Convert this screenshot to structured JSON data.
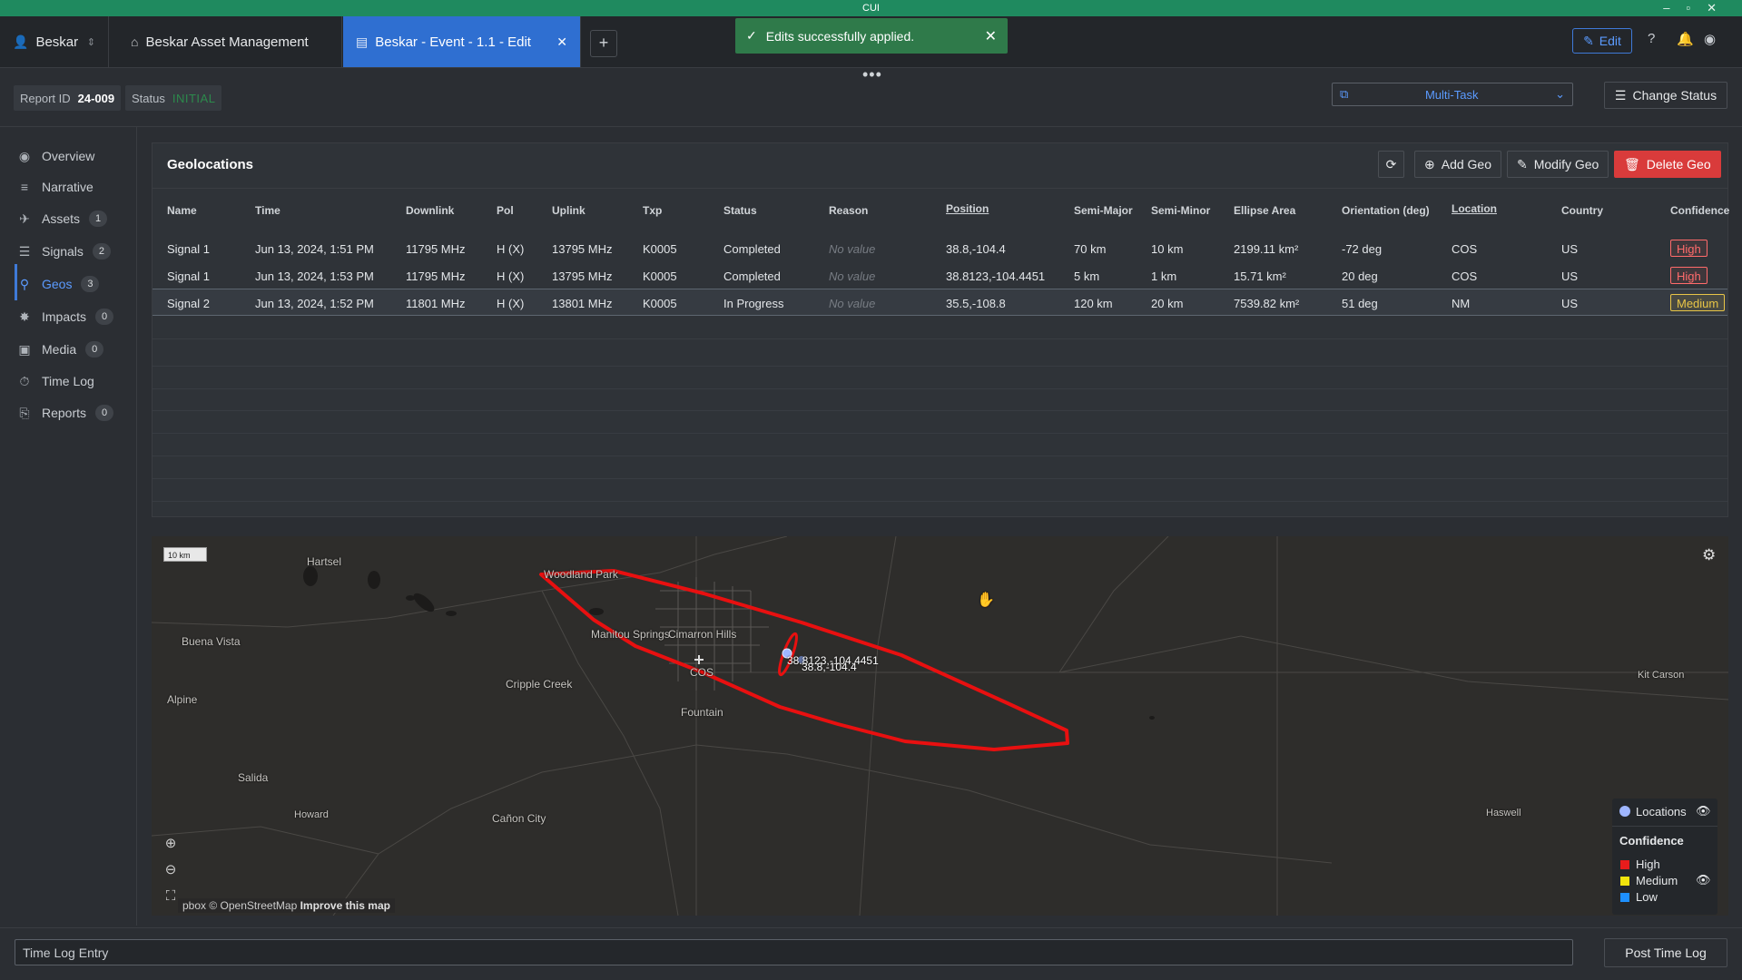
{
  "banner": {
    "classification": "CUI"
  },
  "tabs": [
    {
      "label": "Beskar",
      "icon": "user-badge-icon"
    },
    {
      "label": "Beskar Asset Management",
      "icon": "home-icon"
    },
    {
      "label": "Beskar - Event - 1.1 - Edit",
      "icon": "window-icon"
    }
  ],
  "toast": {
    "message": "Edits successfully applied."
  },
  "header": {
    "edit_label": "Edit"
  },
  "report": {
    "id_label": "Report ID",
    "id_value": "24-009",
    "status_label": "Status",
    "status_value": "INITIAL"
  },
  "toolbar": {
    "ellipsis": "•••",
    "multitask_label": "Multi-Task",
    "change_status_label": "Change Status"
  },
  "sidebar": {
    "items": [
      {
        "label": "Overview",
        "icon": "eye-icon",
        "count": ""
      },
      {
        "label": "Narrative",
        "icon": "lines-icon",
        "count": ""
      },
      {
        "label": "Assets",
        "icon": "plane-icon",
        "count": "1"
      },
      {
        "label": "Signals",
        "icon": "signal-icon",
        "count": "2"
      },
      {
        "label": "Geos",
        "icon": "pin-icon",
        "count": "3"
      },
      {
        "label": "Impacts",
        "icon": "burst-icon",
        "count": "0"
      },
      {
        "label": "Media",
        "icon": "image-icon",
        "count": "0"
      },
      {
        "label": "Time Log",
        "icon": "stopwatch-icon",
        "count": ""
      },
      {
        "label": "Reports",
        "icon": "paperclip-icon",
        "count": "0"
      }
    ]
  },
  "geolocations": {
    "title": "Geolocations",
    "buttons": {
      "add": "Add Geo",
      "modify": "Modify Geo",
      "delete": "Delete Geo"
    },
    "columns": [
      "Name",
      "Time",
      "Downlink",
      "Pol",
      "Uplink",
      "Txp",
      "Status",
      "Reason",
      "Position",
      "Semi-Major",
      "Semi-Minor",
      "Ellipse Area",
      "Orientation (deg)",
      "Location",
      "Country",
      "Confidence"
    ],
    "rows": [
      {
        "name": "Signal 1",
        "time": "Jun 13, 2024, 1:51 PM",
        "downlink": "11795 MHz",
        "pol": "H (X)",
        "uplink": "13795 MHz",
        "txp": "K0005",
        "status": "Completed",
        "reason": "No value",
        "position": "38.8,-104.4",
        "semi_major": "70 km",
        "semi_minor": "10 km",
        "ellipse_area": "2199.11 km²",
        "orientation": "-72 deg",
        "location": "COS",
        "country": "US",
        "confidence": "High"
      },
      {
        "name": "Signal 1",
        "time": "Jun 13, 2024, 1:53 PM",
        "downlink": "11795 MHz",
        "pol": "H (X)",
        "uplink": "13795 MHz",
        "txp": "K0005",
        "status": "Completed",
        "reason": "No value",
        "position": "38.8123,-104.4451",
        "semi_major": "5 km",
        "semi_minor": "1 km",
        "ellipse_area": "15.71 km²",
        "orientation": "20 deg",
        "location": "COS",
        "country": "US",
        "confidence": "High"
      },
      {
        "name": "Signal 2",
        "time": "Jun 13, 2024, 1:52 PM",
        "downlink": "11801 MHz",
        "pol": "H (X)",
        "uplink": "13801 MHz",
        "txp": "K0005",
        "status": "In Progress",
        "reason": "No value",
        "position": "35.5,-108.8",
        "semi_major": "120 km",
        "semi_minor": "20 km",
        "ellipse_area": "7539.82 km²",
        "orientation": "51 deg",
        "location": "NM",
        "country": "US",
        "confidence": "Medium"
      }
    ]
  },
  "map": {
    "scale": "10 km",
    "places": [
      "Hartsel",
      "Woodland Park",
      "Buena Vista",
      "Manitou Springs",
      "Cimarron Hills",
      "COS",
      "Cripple Creek",
      "Fountain",
      "Alpine",
      "Salida",
      "Howard",
      "Cañon City",
      "Kit Carson",
      "Haswell"
    ],
    "markers": {
      "geo2": "38.8123,-104.4451",
      "geo1": "38.8,-104.4"
    },
    "attribution": "pbox © OpenStreetMap",
    "improve_link": "Improve this map",
    "legend": {
      "locations": "Locations",
      "confidence_title": "Confidence",
      "levels": [
        {
          "label": "High",
          "color": "#e81c1c"
        },
        {
          "label": "Medium",
          "color": "#f2e40c"
        },
        {
          "label": "Low",
          "color": "#1e90ff"
        }
      ]
    },
    "ellipse_color": "#e81010"
  },
  "footer": {
    "placeholder": "Time Log Entry",
    "post_label": "Post Time Log"
  }
}
